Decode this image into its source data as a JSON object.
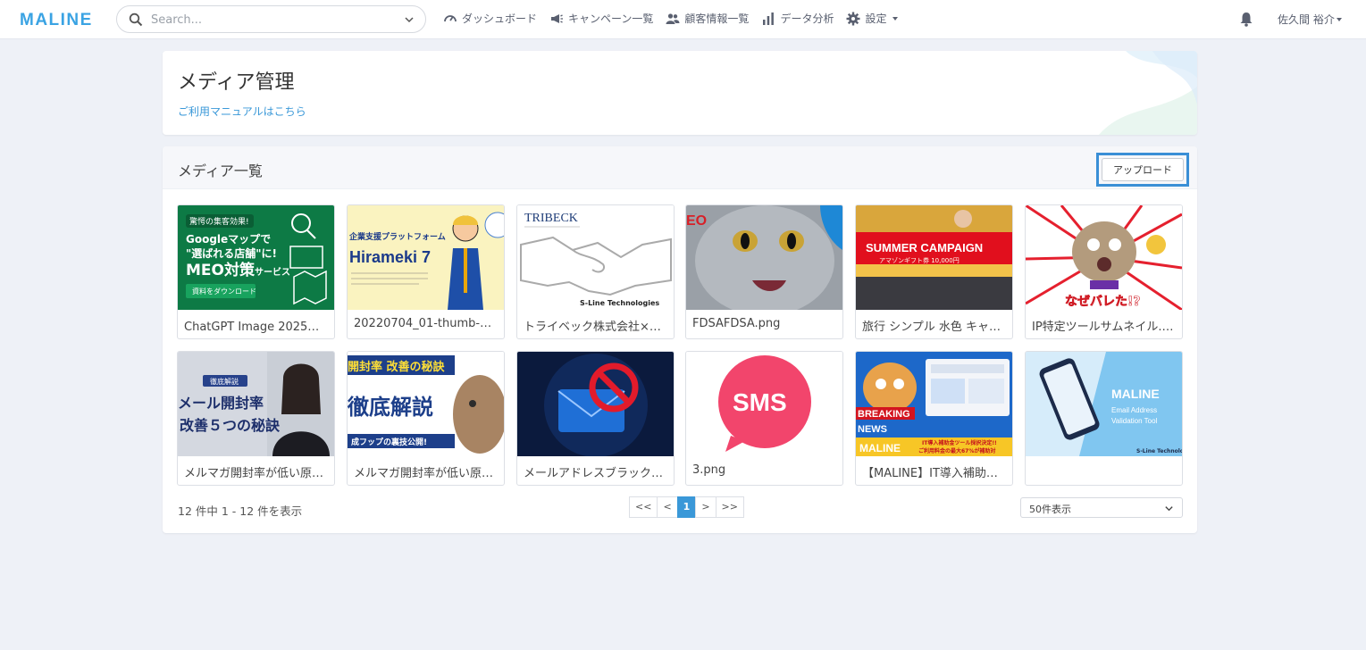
{
  "app": {
    "logo": "MALINE"
  },
  "search": {
    "placeholder": "Search..."
  },
  "nav": {
    "items": [
      {
        "label": "ダッシュボード",
        "icon": "dashboard-icon"
      },
      {
        "label": "キャンペーン一覧",
        "icon": "megaphone-icon"
      },
      {
        "label": "顧客情報一覧",
        "icon": "users-icon"
      },
      {
        "label": "データ分析",
        "icon": "bar-chart-icon"
      },
      {
        "label": "設定",
        "icon": "gear-icon"
      }
    ],
    "user": "佐久間 裕介"
  },
  "header": {
    "title": "メディア管理",
    "manual_link": "ご利用マニュアルはこちら"
  },
  "media": {
    "title": "メディア一覧",
    "upload_label": "アップロード",
    "items": [
      {
        "caption": "ChatGPT Image 2025年5…",
        "thumb_text": "Googleマップで “選ばれる店舗”に! MEO対策サービス",
        "thumb_sub": "驚愕の集客効果!",
        "thumb_btn": "資料をダウンロード"
      },
      {
        "caption": "20220704_01-thumb-720…",
        "thumb_text": "Hirameki 7",
        "thumb_sub": "企業支援プラットフォーム"
      },
      {
        "caption": "トライベック株式会社×…",
        "thumb_text": "TRIBECK",
        "thumb_sub": "S-Line Technologies"
      },
      {
        "caption": "FDSAFDSA.png",
        "thumb_text": "EO"
      },
      {
        "caption": "旅行 シンプル 水色 キャン…",
        "thumb_text": "SUMMER CAMPAIGN",
        "thumb_sub": "アマゾンギフト券 10,000円"
      },
      {
        "caption": "IP特定ツールサムネイル.…",
        "thumb_text": "なぜバレた!?"
      },
      {
        "caption": "メルマガ開封率が低い原…",
        "thumb_text": "メール開封率 改善5つの秘訣",
        "thumb_sub": "徹底解説"
      },
      {
        "caption": "メルマガ開封率が低い原…",
        "thumb_text": "徹底解説",
        "thumb_sub": "開封率 改善の秘訣"
      },
      {
        "caption": "メールアドレスブラック…",
        "thumb_text": ""
      },
      {
        "caption": "3.png",
        "thumb_text": "SMS"
      },
      {
        "caption": "【MALINE】IT導入補助金…",
        "thumb_text": "BREAKING NEWS",
        "thumb_sub": "IT導入補助金ツール採択決定!!"
      },
      {
        "caption": "",
        "thumb_text": "MALINE",
        "thumb_sub": "Email Address Validation Tool"
      }
    ],
    "count_text": "12 件中 1 - 12 件を表示",
    "pager": [
      "<<",
      "<",
      "1",
      ">",
      ">>"
    ],
    "active_page": "1",
    "per_page": "50件表示"
  }
}
